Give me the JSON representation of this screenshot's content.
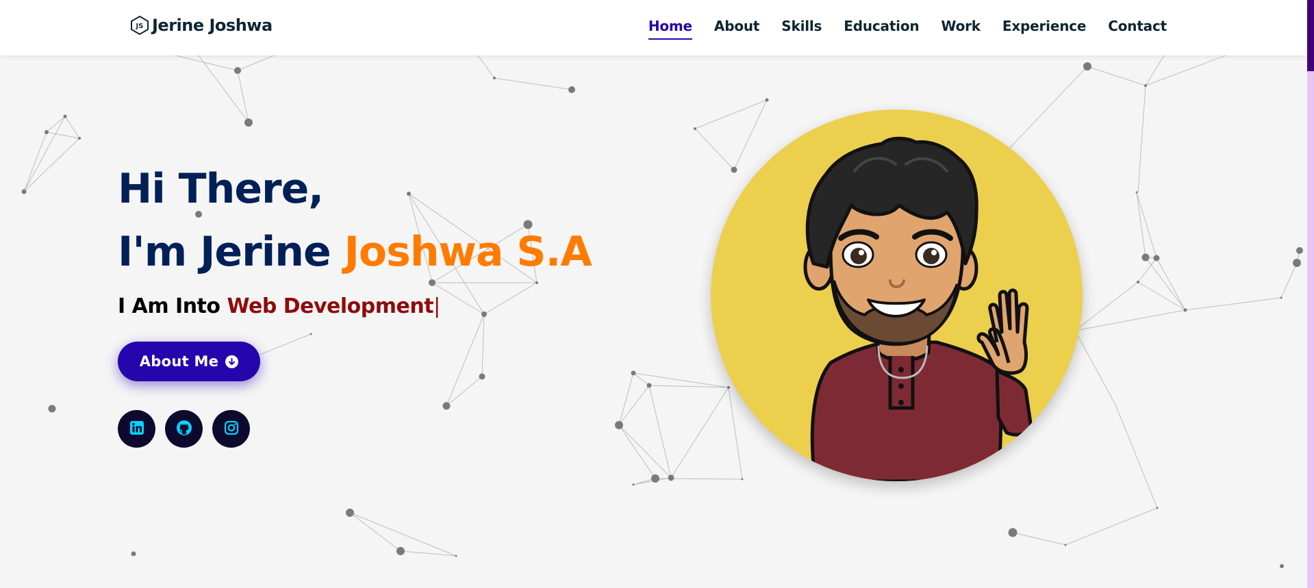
{
  "brand": {
    "name": "Jerine Joshwa",
    "logo_icon": "nodejs-hexagon-icon"
  },
  "nav": {
    "items": [
      {
        "label": "Home",
        "active": true
      },
      {
        "label": "About",
        "active": false
      },
      {
        "label": "Skills",
        "active": false
      },
      {
        "label": "Education",
        "active": false
      },
      {
        "label": "Work",
        "active": false
      },
      {
        "label": "Experience",
        "active": false
      },
      {
        "label": "Contact",
        "active": false
      }
    ]
  },
  "hero": {
    "greeting": "Hi There,",
    "intro_prefix": "I'm Jerine ",
    "intro_accent": "Joshwa S.A",
    "typed_prefix": "I Am Into ",
    "typed_text": "Web Development",
    "typed_cursor": "|",
    "button_label": "About Me",
    "button_icon": "arrow-circle-down-icon"
  },
  "socials": [
    {
      "name": "linkedin",
      "icon": "linkedin-icon"
    },
    {
      "name": "github",
      "icon": "github-icon"
    },
    {
      "name": "instagram",
      "icon": "instagram-icon"
    }
  ],
  "avatar": {
    "description_icon": "waving-cartoon-avatar"
  },
  "colors": {
    "primary": "#2506ad",
    "heading": "#002057",
    "accent": "#ff7b00",
    "typed": "#8f0b0b",
    "avatar_bg": "#eccf4d",
    "social_bg": "#0e0a2d",
    "social_icon": "#00d4ff",
    "scroll_thumb": "#420177",
    "scroll_track": "#e8c4f4"
  }
}
